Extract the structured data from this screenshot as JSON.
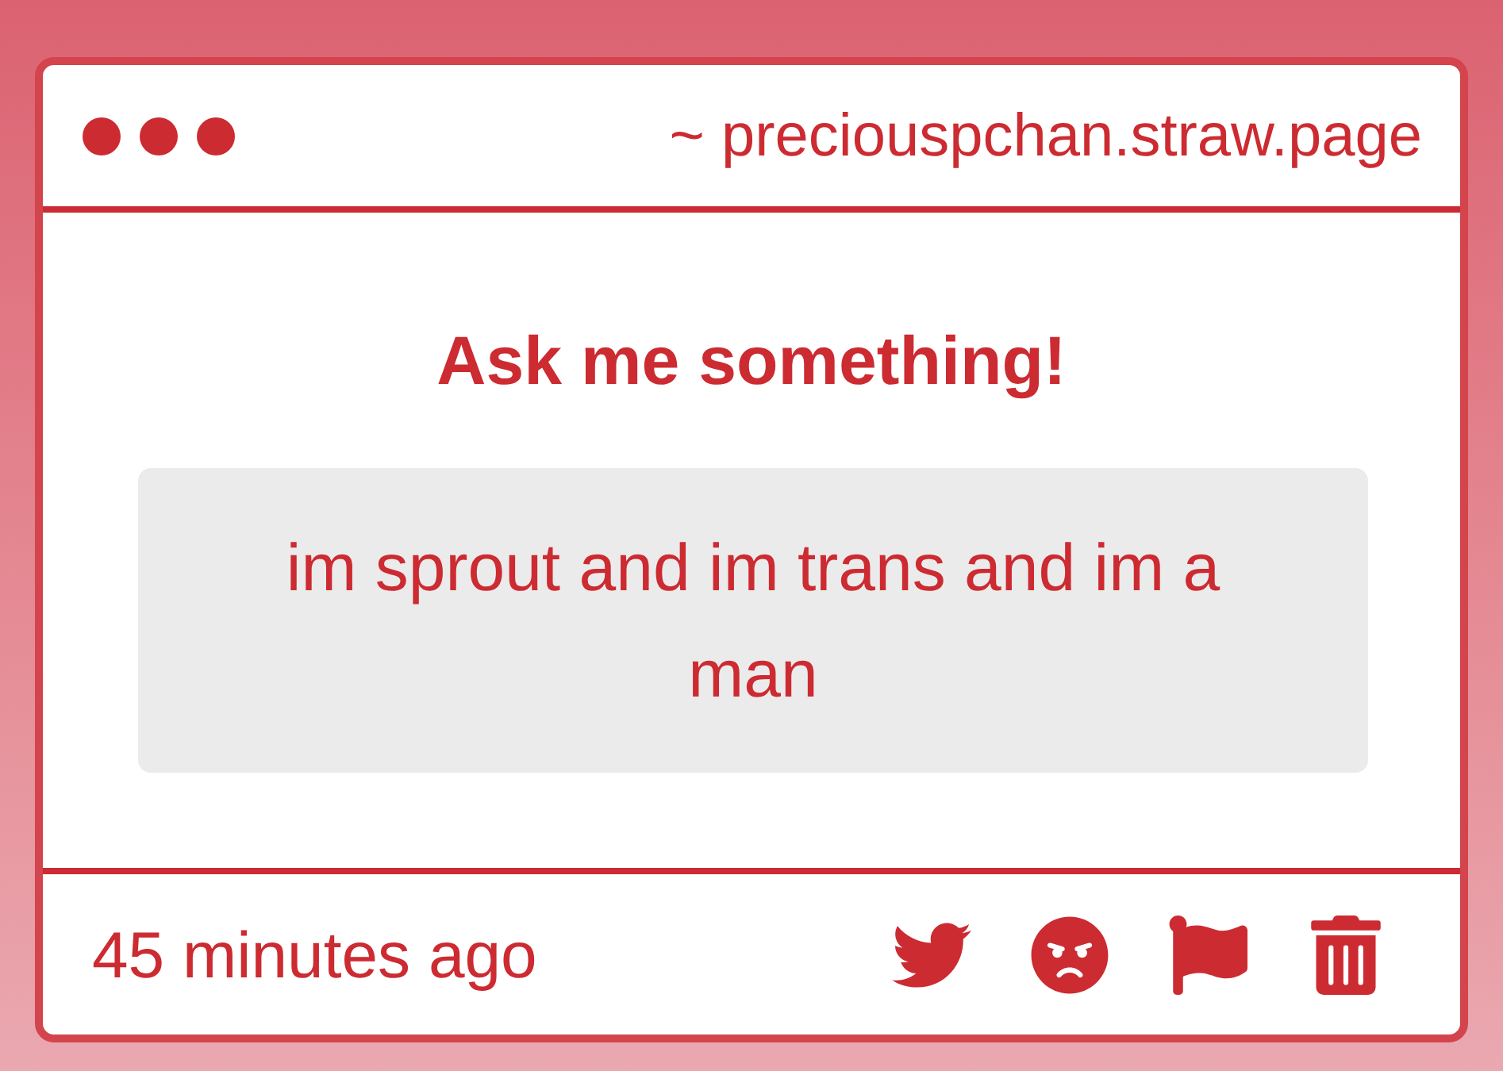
{
  "window": {
    "address": "~ preciouspchan.straw.page"
  },
  "prompt": {
    "title": "Ask me something!"
  },
  "question": {
    "text": "im sprout and im trans and im a man"
  },
  "footer": {
    "time": "45 minutes ago",
    "actions": [
      {
        "kind": "share"
      },
      {
        "kind": "angry"
      },
      {
        "kind": "report"
      },
      {
        "kind": "delete"
      }
    ]
  }
}
